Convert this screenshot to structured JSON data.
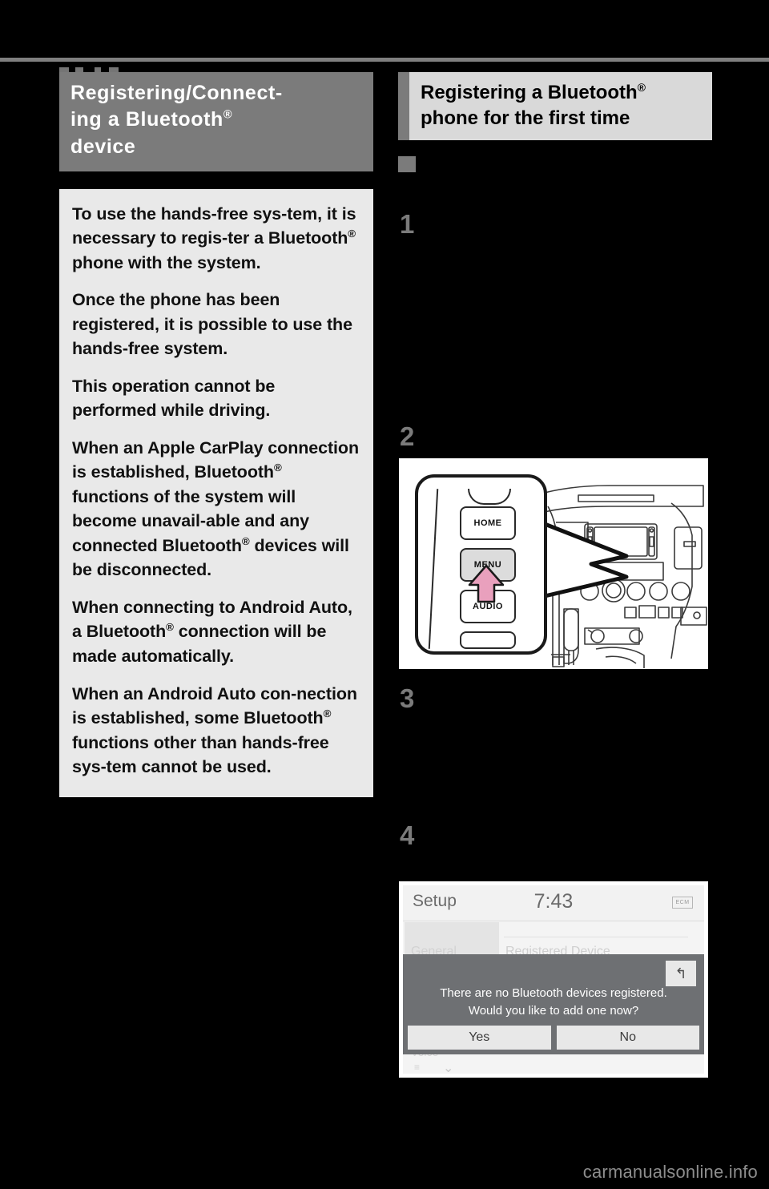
{
  "page": {
    "background": "#000000",
    "rule_color": "#7f7f7f",
    "watermark": "carmanualsonline.info"
  },
  "left_column": {
    "heading": {
      "line1": "Registering/Connect-",
      "line2_pre": "ing a Bluetooth",
      "line2_sup": "®",
      "line3": "device",
      "bg": "#7b7b7b",
      "fg": "#ffffff"
    },
    "note_box": {
      "bg": "#e9e9e9",
      "paragraphs": [
        {
          "pre": "To use the hands-free sys-tem, it is necessary to regis-ter a Bluetooth",
          "sup": "®",
          "post": " phone with the system."
        },
        {
          "pre": "Once the phone has been registered, it is possible to use the hands-free system.",
          "sup": "",
          "post": ""
        },
        {
          "pre": "This operation cannot be performed while driving.",
          "sup": "",
          "post": ""
        },
        {
          "pre": "When an Apple CarPlay connection is established, Bluetooth",
          "sup": "®",
          "post": " functions of the system will become unavail-able and any connected Bluetooth"
        },
        {
          "pre": "When connecting to Android Auto, a Bluetooth",
          "sup": "®",
          "post": " connection will be made automatically."
        },
        {
          "pre": "When an Android Auto con-nection is established, some Bluetooth",
          "sup": "®",
          "post": " functions other than hands-free sys-tem cannot be used."
        }
      ],
      "devices_tail": {
        "sup": "®",
        "text": " devices will be disconnected."
      }
    }
  },
  "right_column": {
    "heading": {
      "line1_pre": "Registering a Bluetooth",
      "line1_sup": "®",
      "line2": "phone for the first time",
      "accent_bg": "#7b7b7b",
      "box_bg": "#d9d9d9"
    },
    "bullet_marker": "square-bullet",
    "bullet_text": "",
    "steps": [
      {
        "number": "1",
        "text": ""
      },
      {
        "number": "2",
        "text": ""
      },
      {
        "number": "3",
        "text": ""
      },
      {
        "number": "4",
        "text": ""
      }
    ]
  },
  "figure_dashboard": {
    "buttons": {
      "home": "HOME",
      "menu": "MENU",
      "audio": "AUDIO"
    },
    "arrow_color": "#e9a0bd",
    "highlight_button": "MENU"
  },
  "figure_headunit": {
    "title": "Setup",
    "clock": "7:43",
    "status_icon": "ECM",
    "ghost_tab": "General",
    "ghost_heading": "Registered Device",
    "ghost_lower": "Voice",
    "dialog": {
      "message_line1": "There are no Bluetooth devices registered.",
      "message_line2": "Would you like to add one now?",
      "back_icon": "back-arrow-icon",
      "buttons": [
        "Yes",
        "No"
      ],
      "bg": "#6e7073"
    }
  }
}
